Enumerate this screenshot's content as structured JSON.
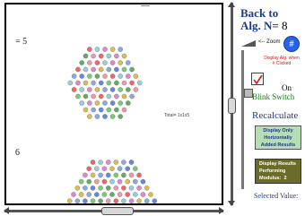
{
  "canvas": {
    "n5_label": "= 5",
    "n6_label": "6",
    "small_label": "Total= 1x1x5"
  },
  "panel": {
    "back_line1": "Back to",
    "back_line2": "Alg. N=",
    "n_value": "8",
    "zoom_label": "<-- Zoom",
    "hash_label": "#",
    "display_alg_line1": "Display Alg. when",
    "display_alg_line2": "# Clicked",
    "on_label": "On",
    "blink_switch": "Blink Switch",
    "recalculate": "Recalculate",
    "display_only": [
      "Display Only",
      "Horizontally",
      "Added Results"
    ],
    "display_results": [
      "Display Results",
      "Performing",
      "Modulus:"
    ],
    "modulus_value": "2",
    "selected_value": "Selected Value:"
  },
  "colors": {
    "dot_palette": [
      "#e66",
      "#e9a",
      "#6a6",
      "#7c7",
      "#68d",
      "#8ad",
      "#db5",
      "#d8c",
      "#9cd"
    ]
  }
}
